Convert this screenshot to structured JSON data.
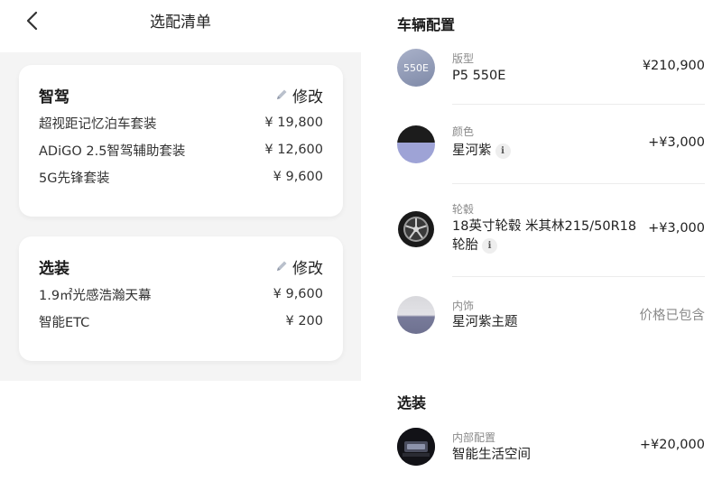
{
  "header": {
    "title": "选配清单"
  },
  "left": {
    "cards": [
      {
        "title": "智驾",
        "edit_label": "修改",
        "rows": [
          {
            "label": "超视距记忆泊车套装",
            "price": "¥ 19,800"
          },
          {
            "label": "ADiGO 2.5智驾辅助套装",
            "price": "¥ 12,600"
          },
          {
            "label": "5G先锋套装",
            "price": "¥ 9,600"
          }
        ]
      },
      {
        "title": "选装",
        "edit_label": "修改",
        "rows": [
          {
            "label": "1.9㎡光感浩瀚天幕",
            "price": "¥ 9,600"
          },
          {
            "label": "智能ETC",
            "price": "¥ 200"
          }
        ]
      }
    ]
  },
  "right": {
    "config_title": "车辆配置",
    "items": [
      {
        "category": "版型",
        "name": "P5 550E",
        "price": "¥210,900",
        "thumb_text": "550E"
      },
      {
        "category": "颜色",
        "name": "星河紫",
        "price": "+¥3,000"
      },
      {
        "category": "轮毂",
        "name_line1": "18英寸轮毂 米其林215/50R18",
        "name_line2": "轮胎",
        "price": "+¥3,000"
      },
      {
        "category": "内饰",
        "name": "星河紫主题",
        "price": "价格已包含"
      }
    ],
    "options_title": "选装",
    "options": [
      {
        "category": "内部配置",
        "name": "智能生活空间",
        "price": "+¥20,000"
      }
    ]
  },
  "icons": {
    "back": "chevron-left-icon",
    "edit": "pencil-icon",
    "info": "info-icon"
  },
  "colors": {
    "panel_bg": "#f4f4f4",
    "color_swatch_purple": "#9ea3d6",
    "muted_text": "#8a8a8a"
  }
}
